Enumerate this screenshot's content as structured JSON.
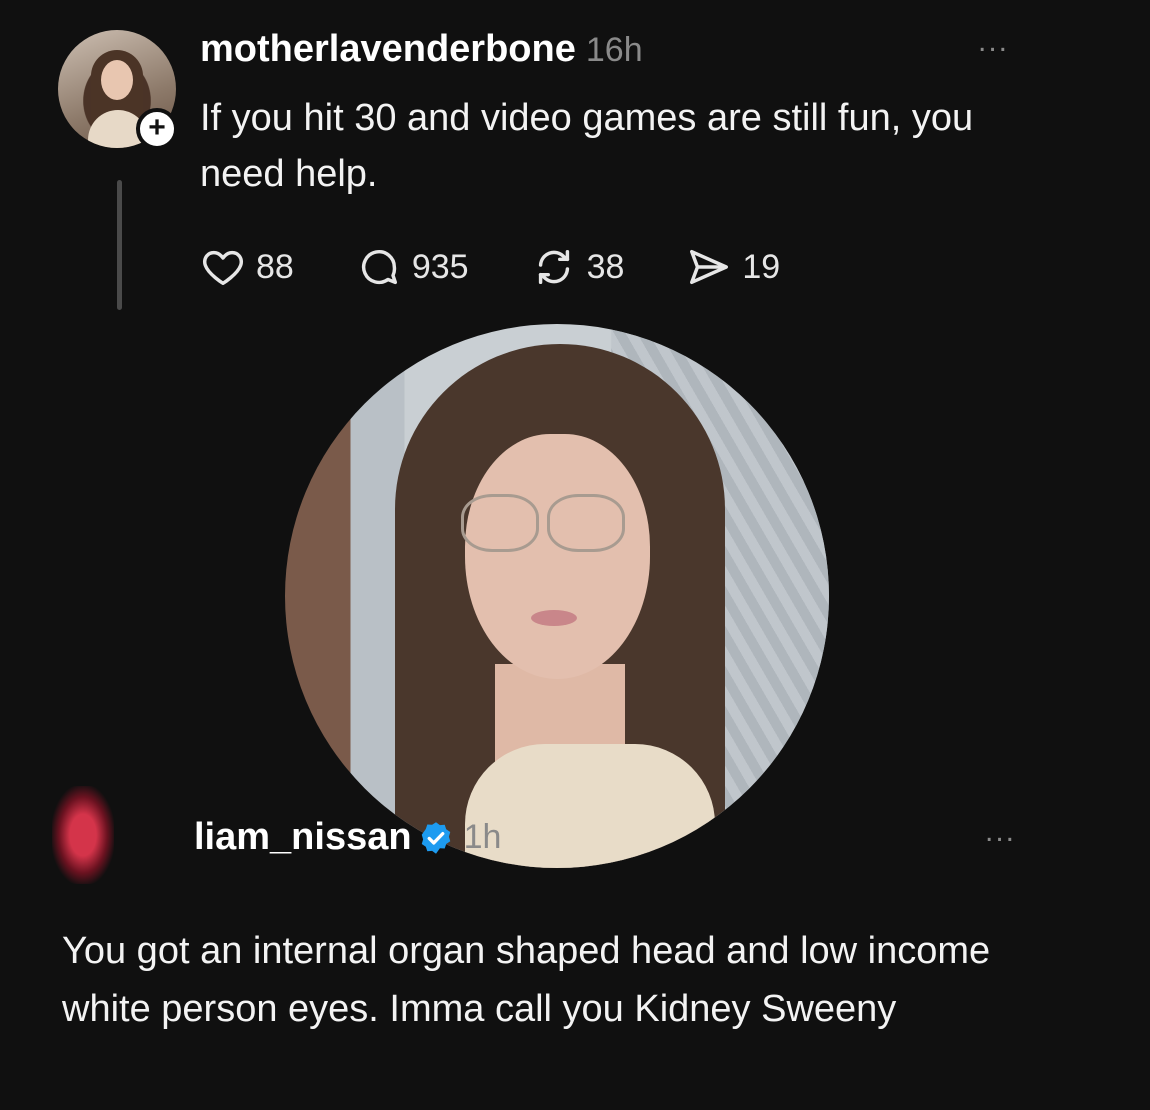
{
  "post": {
    "username": "motherlavenderbone",
    "time": "16h",
    "text": "If you hit 30 and video games are still fun, you need help.",
    "follow_symbol": "+",
    "more_symbol": "...",
    "stats": {
      "likes": "88",
      "comments": "935",
      "reposts": "38",
      "shares": "19"
    },
    "icons": [
      "heart-icon",
      "comment-icon",
      "repost-icon",
      "share-icon"
    ]
  },
  "reply": {
    "username": "liam_nissan",
    "time": "1h",
    "more_symbol": "...",
    "text": "You got an internal organ shaped head and low income white person eyes. Imma call you Kidney Sweeny"
  },
  "colors": {
    "background": "#101010",
    "text": "#f3f3f3",
    "muted": "#8a8a8a",
    "verified": "#1d9bf0"
  }
}
